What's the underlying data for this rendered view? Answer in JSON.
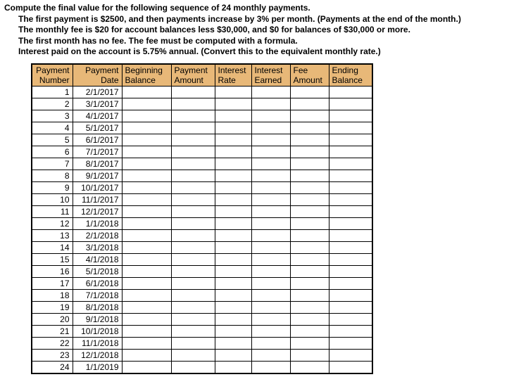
{
  "heading": {
    "line1": "Compute the final value for the following sequence of 24 monthly payments.",
    "line2": "The first payment is $2500, and then payments increase by 3% per month.  (Payments at the end of the month.)",
    "line3": "The monthly fee is $20 for account balances less $30,000, and $0 for balances of $30,000 or more.",
    "line4": "The first month has no fee.  The fee must be computed with a formula.",
    "line5": "Interest paid on the account is 5.75% annual.  (Convert this to the equivalent monthly rate.)"
  },
  "columns": {
    "num": "Payment Number",
    "date": "Payment Date",
    "beg": "Beginning Balance",
    "pay": "Payment Amount",
    "rate": "Interest Rate",
    "int": "Interest Earned",
    "fee": "Fee Amount",
    "end": "Ending Balance"
  },
  "rows": [
    {
      "num": "1",
      "date": "2/1/2017"
    },
    {
      "num": "2",
      "date": "3/1/2017"
    },
    {
      "num": "3",
      "date": "4/1/2017"
    },
    {
      "num": "4",
      "date": "5/1/2017"
    },
    {
      "num": "5",
      "date": "6/1/2017"
    },
    {
      "num": "6",
      "date": "7/1/2017"
    },
    {
      "num": "7",
      "date": "8/1/2017"
    },
    {
      "num": "8",
      "date": "9/1/2017"
    },
    {
      "num": "9",
      "date": "10/1/2017"
    },
    {
      "num": "10",
      "date": "11/1/2017"
    },
    {
      "num": "11",
      "date": "12/1/2017"
    },
    {
      "num": "12",
      "date": "1/1/2018"
    },
    {
      "num": "13",
      "date": "2/1/2018"
    },
    {
      "num": "14",
      "date": "3/1/2018"
    },
    {
      "num": "15",
      "date": "4/1/2018"
    },
    {
      "num": "16",
      "date": "5/1/2018"
    },
    {
      "num": "17",
      "date": "6/1/2018"
    },
    {
      "num": "18",
      "date": "7/1/2018"
    },
    {
      "num": "19",
      "date": "8/1/2018"
    },
    {
      "num": "20",
      "date": "9/1/2018"
    },
    {
      "num": "21",
      "date": "10/1/2018"
    },
    {
      "num": "22",
      "date": "11/1/2018"
    },
    {
      "num": "23",
      "date": "12/1/2018"
    },
    {
      "num": "24",
      "date": "1/1/2019"
    }
  ]
}
